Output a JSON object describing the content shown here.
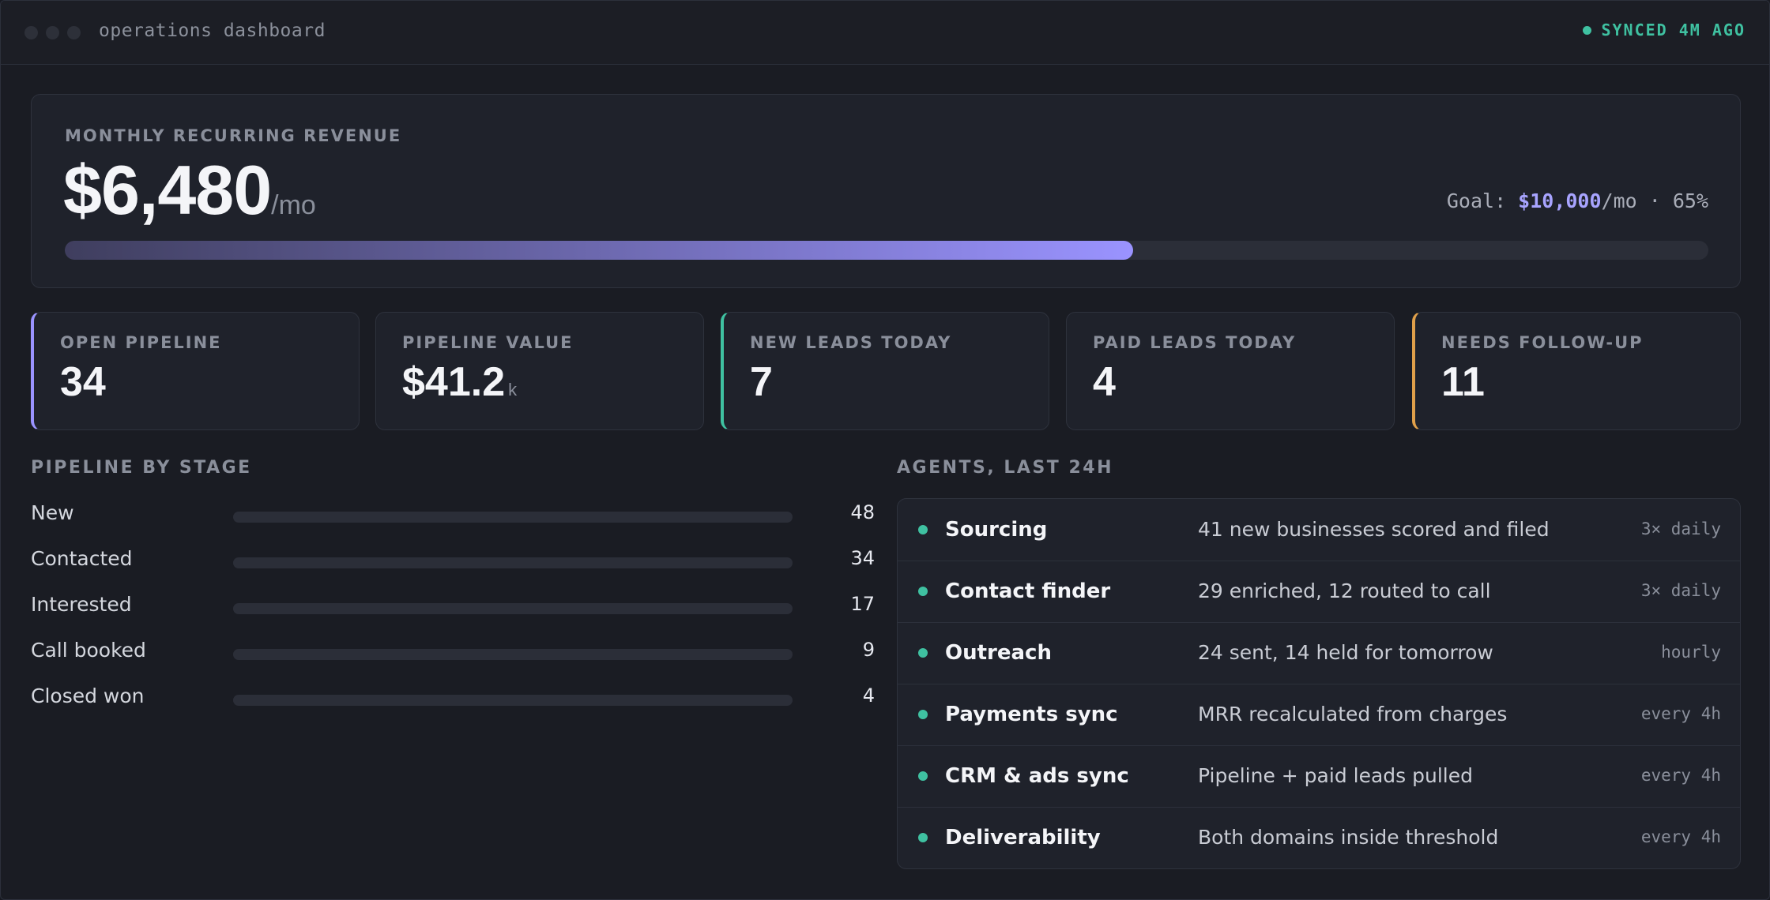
{
  "window": {
    "title": "operations dashboard",
    "sync_status": "SYNCED 4M AGO"
  },
  "colors": {
    "accent": "#9a93ff",
    "teal": "#3fc1a1",
    "orange": "#e0a04a",
    "background": "#1a1c23",
    "card": "#1f222b"
  },
  "mrr": {
    "label": "MONTHLY RECURRING REVENUE",
    "value": "$6,480",
    "unit": "/mo",
    "goal_prefix": "Goal: ",
    "goal_value": "$10,000",
    "goal_suffix": "/mo · 65%",
    "progress": 0.65
  },
  "stats": [
    {
      "label": "OPEN PIPELINE",
      "value": "34",
      "suffix": "",
      "accent": "#9a93ff"
    },
    {
      "label": "PIPELINE VALUE",
      "value": "$41.2",
      "suffix": "k",
      "accent": ""
    },
    {
      "label": "NEW LEADS TODAY",
      "value": "7",
      "suffix": "",
      "accent": "#3fc1a1"
    },
    {
      "label": "PAID LEADS TODAY",
      "value": "4",
      "suffix": "",
      "accent": ""
    },
    {
      "label": "NEEDS FOLLOW-UP",
      "value": "11",
      "suffix": "",
      "accent": "#e0a04a"
    }
  ],
  "pipeline": {
    "title": "PIPELINE BY STAGE",
    "stages": [
      {
        "name": "New",
        "count": "48"
      },
      {
        "name": "Contacted",
        "count": "34"
      },
      {
        "name": "Interested",
        "count": "17"
      },
      {
        "name": "Call booked",
        "count": "9"
      },
      {
        "name": "Closed won",
        "count": "4"
      }
    ]
  },
  "agents": {
    "title": "AGENTS, LAST 24H",
    "rows": [
      {
        "name": "Sourcing",
        "desc": "41 new businesses scored and filed",
        "freq": "3× daily"
      },
      {
        "name": "Contact finder",
        "desc": "29 enriched, 12 routed to call",
        "freq": "3× daily"
      },
      {
        "name": "Outreach",
        "desc": "24 sent, 14 held for tomorrow",
        "freq": "hourly"
      },
      {
        "name": "Payments sync",
        "desc": "MRR recalculated from charges",
        "freq": "every 4h"
      },
      {
        "name": "CRM & ads sync",
        "desc": "Pipeline + paid leads pulled",
        "freq": "every 4h"
      },
      {
        "name": "Deliverability",
        "desc": "Both domains inside threshold",
        "freq": "every 4h"
      }
    ]
  }
}
